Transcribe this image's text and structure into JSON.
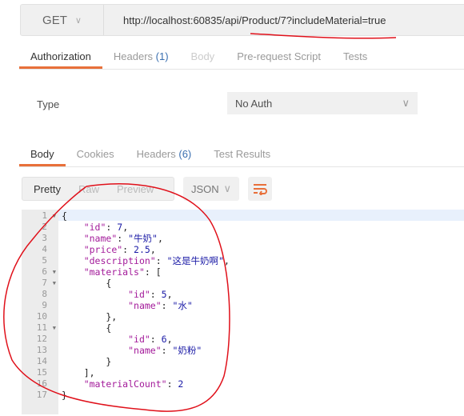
{
  "request": {
    "method": "GET",
    "url": "http://localhost:60835/api/Product/7?includeMaterial=true"
  },
  "request_tabs": [
    {
      "label": "Authorization",
      "active": true
    },
    {
      "label": "Headers",
      "count": "(1)"
    },
    {
      "label": "Body",
      "disabled": true
    },
    {
      "label": "Pre-request Script"
    },
    {
      "label": "Tests"
    }
  ],
  "auth": {
    "type_label": "Type",
    "value": "No Auth"
  },
  "response_tabs": [
    {
      "label": "Body",
      "active": true
    },
    {
      "label": "Cookies"
    },
    {
      "label": "Headers",
      "count": "(6)"
    },
    {
      "label": "Test Results"
    }
  ],
  "view": {
    "modes": [
      "Pretty",
      "Raw",
      "Preview"
    ],
    "format": "JSON"
  },
  "colors": {
    "accent": "#e8703a",
    "annotation": "#e0101a"
  },
  "code_lines": [
    [
      [
        "{",
        "p"
      ]
    ],
    [
      [
        "    ",
        "p"
      ],
      [
        "\"id\"",
        "k"
      ],
      [
        ": ",
        "p"
      ],
      [
        "7",
        "n"
      ],
      [
        ",",
        "p"
      ]
    ],
    [
      [
        "    ",
        "p"
      ],
      [
        "\"name\"",
        "k"
      ],
      [
        ": ",
        "p"
      ],
      [
        "\"牛奶\"",
        "s"
      ],
      [
        ",",
        "p"
      ]
    ],
    [
      [
        "    ",
        "p"
      ],
      [
        "\"price\"",
        "k"
      ],
      [
        ": ",
        "p"
      ],
      [
        "2.5",
        "n"
      ],
      [
        ",",
        "p"
      ]
    ],
    [
      [
        "    ",
        "p"
      ],
      [
        "\"description\"",
        "k"
      ],
      [
        ": ",
        "p"
      ],
      [
        "\"这是牛奶啊\"",
        "s"
      ],
      [
        ",",
        "p"
      ]
    ],
    [
      [
        "    ",
        "p"
      ],
      [
        "\"materials\"",
        "k"
      ],
      [
        ": [",
        "p"
      ]
    ],
    [
      [
        "        {",
        "p"
      ]
    ],
    [
      [
        "            ",
        "p"
      ],
      [
        "\"id\"",
        "k"
      ],
      [
        ": ",
        "p"
      ],
      [
        "5",
        "n"
      ],
      [
        ",",
        "p"
      ]
    ],
    [
      [
        "            ",
        "p"
      ],
      [
        "\"name\"",
        "k"
      ],
      [
        ": ",
        "p"
      ],
      [
        "\"水\"",
        "s"
      ]
    ],
    [
      [
        "        },",
        "p"
      ]
    ],
    [
      [
        "        {",
        "p"
      ]
    ],
    [
      [
        "            ",
        "p"
      ],
      [
        "\"id\"",
        "k"
      ],
      [
        ": ",
        "p"
      ],
      [
        "6",
        "n"
      ],
      [
        ",",
        "p"
      ]
    ],
    [
      [
        "            ",
        "p"
      ],
      [
        "\"name\"",
        "k"
      ],
      [
        ": ",
        "p"
      ],
      [
        "\"奶粉\"",
        "s"
      ]
    ],
    [
      [
        "        }",
        "p"
      ]
    ],
    [
      [
        "    ],",
        "p"
      ]
    ],
    [
      [
        "    ",
        "p"
      ],
      [
        "\"materialCount\"",
        "k"
      ],
      [
        ": ",
        "p"
      ],
      [
        "2",
        "n"
      ]
    ],
    [
      [
        "}",
        "p"
      ]
    ]
  ],
  "foldable_lines": [
    1,
    6,
    7,
    11
  ]
}
